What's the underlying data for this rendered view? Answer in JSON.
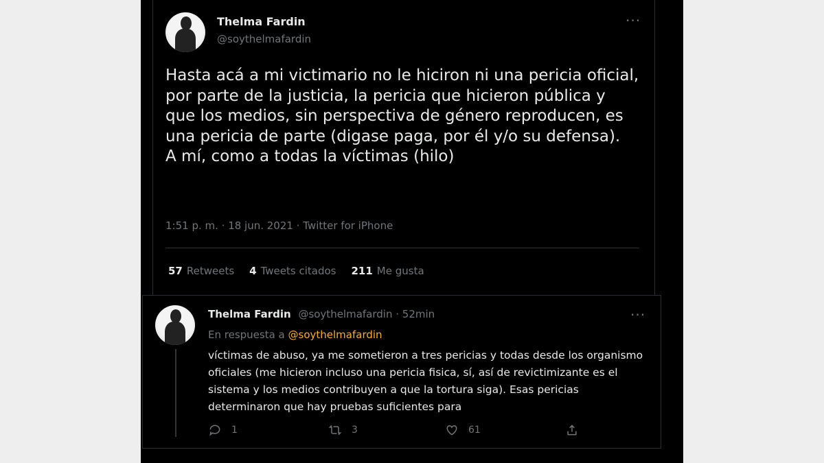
{
  "tweet": {
    "author_name": "Thelma Fardin",
    "author_handle": "@soythelmafardin",
    "more_icon": "more-horizontal-icon",
    "text_lines": [
      "Hasta acá a mi victimario no le hiciron ni una pericia oficial, por parte de la justicia, la pericia que hicieron pública y que los medios, sin perspectiva de género reproducen, es una pericia de parte (digase paga, por él y/o su defensa).",
      "A mí, como a todas la víctimas (hilo)"
    ],
    "timestamp": "1:51 p. m. · 18 jun. 2021 · Twitter for iPhone",
    "stats": {
      "retweets_count": "57",
      "retweets_label": "Retweets",
      "quotes_count": "4",
      "quotes_label": "Tweets citados",
      "likes_count": "211",
      "likes_label": "Me gusta"
    }
  },
  "reply": {
    "author_name": "Thelma Fardin",
    "author_handle": "@soythelmafardin",
    "time": "· 52min",
    "reply_prefix": "En respuesta a",
    "reply_to": "@soythelmafardin",
    "text": "víctimas de abuso, ya me sometieron a tres pericias y todas desde los organismo oficiales (me hicieron incluso una pericia fisica, sí, así de revictimizante es el sistema y los medios contribuyen a que la tortura siga). Esas pericias determinaron que hay pruebas suficientes para",
    "actions": {
      "reply_count": "1",
      "retweet_count": "3",
      "like_count": "61"
    },
    "colors": {
      "mention": "#ffad1f"
    }
  }
}
